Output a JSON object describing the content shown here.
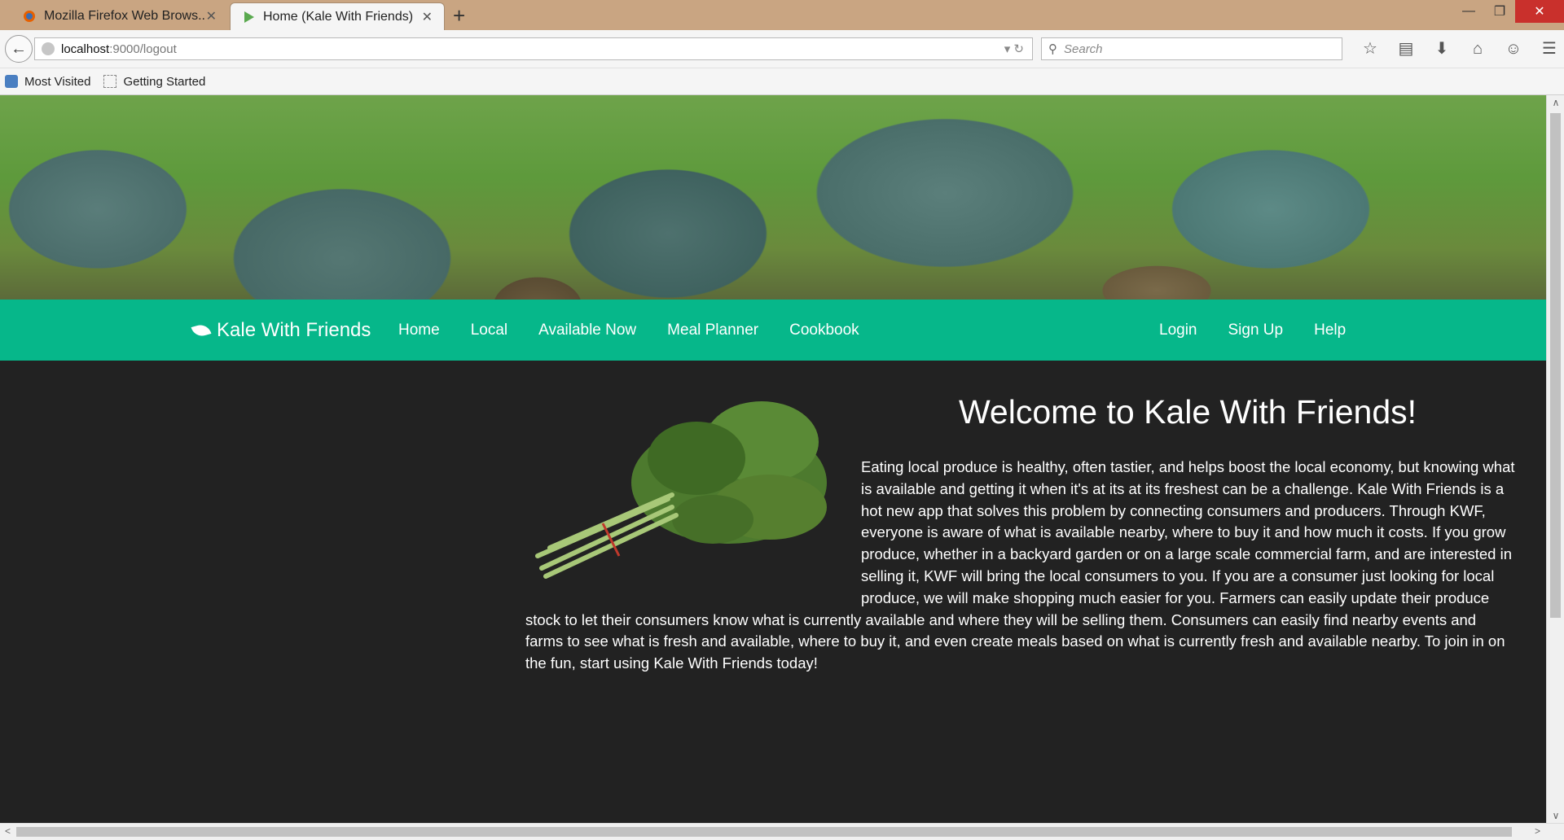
{
  "browser": {
    "tabs": [
      {
        "label": "Mozilla Firefox Web Brows...",
        "icon": "firefox-icon"
      },
      {
        "label": "Home (Kale With Friends)",
        "icon": "play-icon"
      }
    ],
    "url_host": "localhost",
    "url_rest": ":9000/logout",
    "search_placeholder": "Search",
    "bookmarks": [
      {
        "label": "Most Visited"
      },
      {
        "label": "Getting Started"
      }
    ]
  },
  "site": {
    "brand": "Kale With Friends",
    "nav_left": [
      "Home",
      "Local",
      "Available Now",
      "Meal Planner",
      "Cookbook"
    ],
    "nav_right": [
      "Login",
      "Sign Up",
      "Help"
    ],
    "welcome_title": "Welcome to Kale With Friends!",
    "intro": "Eating local produce is healthy, often tastier, and helps boost the local economy, but knowing what is available and getting it when it's at its at its freshest can be a challenge. Kale With Friends is a hot new app that solves this problem by connecting consumers and producers. Through KWF, everyone is aware of what is available nearby, where to buy it and how much it costs. If you grow produce, whether in a backyard garden or on a large scale commercial farm, and are interested in selling it, KWF will bring the local consumers to you. If you are a consumer just looking for local produce, we will make shopping much easier for you. Farmers can easily update their produce stock to let their consumers know what is currently available and where they will be selling them. Consumers can easily find nearby events and farms to see what is fresh and available, where to buy it, and even create meals based on what is currently fresh and available nearby. To join in on the fun, start using Kale With Friends today!"
  },
  "colors": {
    "nav_green": "#06b78a",
    "page_bg": "#222222",
    "tabstrip": "#c9a582"
  }
}
